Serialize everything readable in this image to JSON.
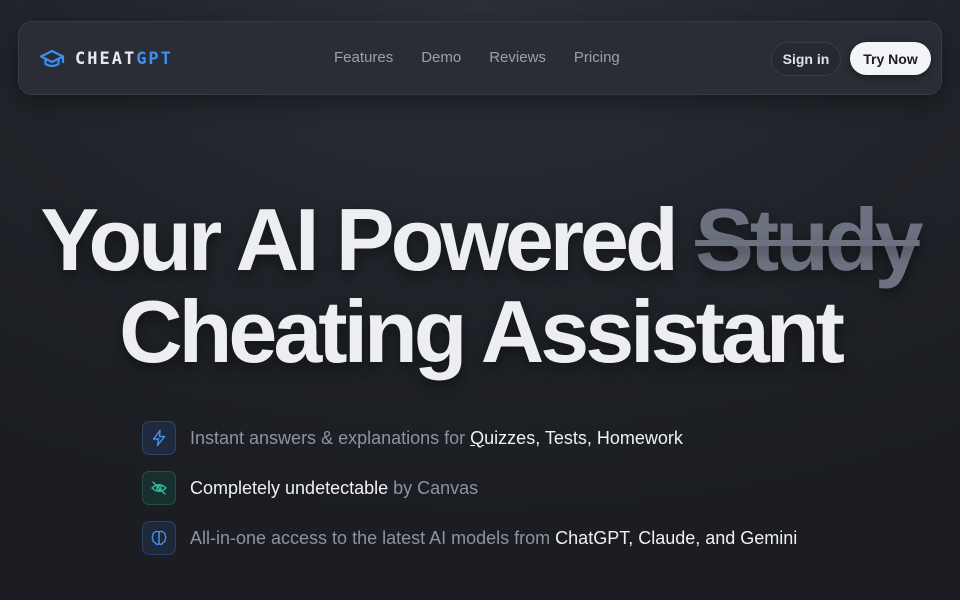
{
  "brand": {
    "part1": "CHEAT",
    "part2": "GPT",
    "icon": "graduation-cap-icon",
    "accent": "#3b8ff0"
  },
  "nav": {
    "links": [
      "Features",
      "Demo",
      "Reviews",
      "Pricing"
    ],
    "signin": "Sign in",
    "cta": "Try Now"
  },
  "hero": {
    "line1_prefix": "Your AI Powered ",
    "line1_struck": "Study",
    "line2": "Cheating Assistant"
  },
  "features": [
    {
      "icon": "lightning-icon",
      "pre": "Instant answers & explanations for ",
      "hl_ul": "Q",
      "hl": "uizzes, Tests, Homework",
      "post": ""
    },
    {
      "icon": "eye-off-icon",
      "pre": "",
      "hl": "Completely undetectable",
      "post": " by Canvas"
    },
    {
      "icon": "brain-icon",
      "pre": "All-in-one access to the latest AI models from ",
      "hl": "ChatGPT, Claude, and Gemini",
      "post": ""
    }
  ]
}
